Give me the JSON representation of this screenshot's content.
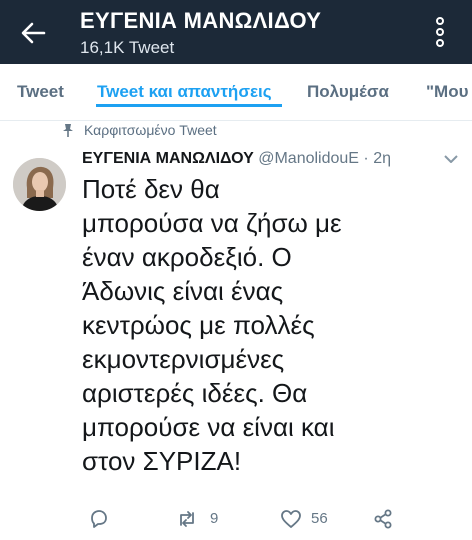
{
  "header": {
    "title": "ΕΥΓΕΝΙΑ ΜΑΝΩΛΙΔΟΥ",
    "subtitle": "16,1K Tweet",
    "back_icon": "arrow-left-icon",
    "more_icon": "more-vertical-icon",
    "background": "#1c2938"
  },
  "tabs": [
    {
      "label": "Tweet",
      "active": false
    },
    {
      "label": "Tweet και απαντήσεις",
      "active": true
    },
    {
      "label": "Πολυμέσα",
      "active": false
    },
    {
      "label": "\"Μου α",
      "active": false
    }
  ],
  "pinned_label": "Καρφιτσωμένο Tweet",
  "tweet": {
    "author_name": "ΕΥΓΕΝΙΑ ΜΑΝΩΛΙΔΟΥ",
    "handle": "@ManolidouE",
    "separator": "·",
    "time": "2η",
    "text": "Ποτέ δεν θα\nμπορούσα να ζήσω με\nέναν ακροδεξιό. Ο\nΆδωνις είναι ένας\nκεντρώος με πολλές\nεκμοντερνισμένες\nαριστερές ιδέες.  Θα\nμπορούσε να είναι και\nστον ΣΥΡΙΖΑ!",
    "retweets": "9",
    "likes": "56"
  },
  "colors": {
    "accent": "#1da1f2",
    "muted": "#657786",
    "text": "#14171a"
  }
}
